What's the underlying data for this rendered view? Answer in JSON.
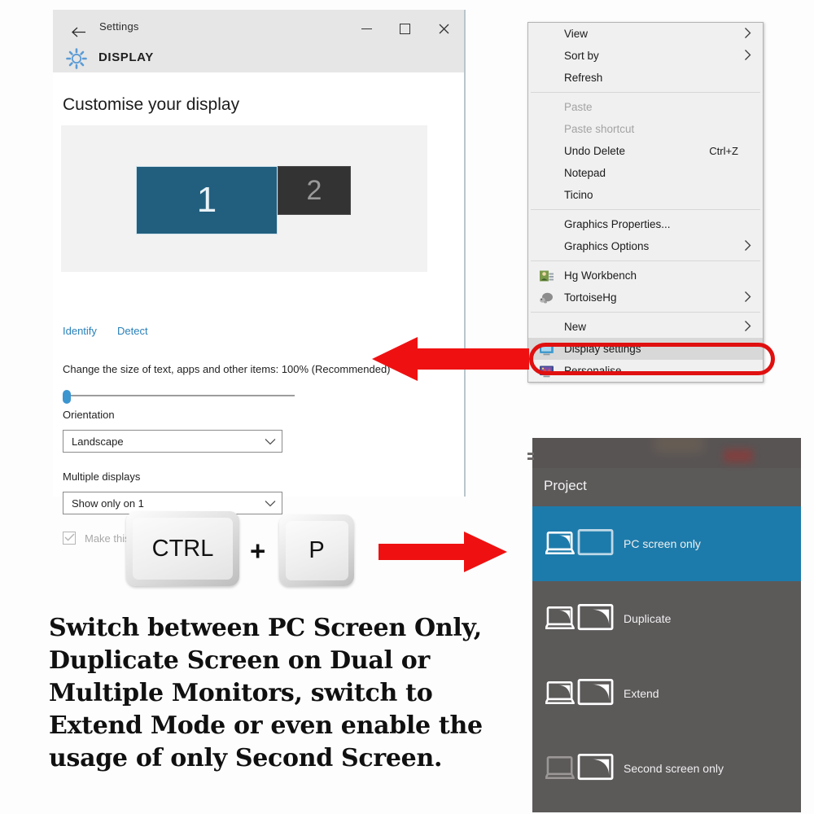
{
  "settings_window": {
    "titlebar": {
      "back_icon": "back-arrow-icon",
      "title": "Settings",
      "minimize": "minimize-icon",
      "maximize": "maximize-icon",
      "close": "close-icon"
    },
    "header": {
      "icon": "gear-icon",
      "label": "DISPLAY"
    },
    "heading": "Customise your display",
    "monitors": [
      {
        "label": "1",
        "color": "#225f7f",
        "state": "selected"
      },
      {
        "label": "2",
        "color": "#333333",
        "state": "normal"
      }
    ],
    "links": {
      "identify": "Identify",
      "detect": "Detect"
    },
    "scale": {
      "label": "Change the size of text, apps and other items: 100% (Recommended)",
      "value": 0
    },
    "orientation": {
      "label": "Orientation",
      "value": "Landscape",
      "caret": "chevron-down-icon"
    },
    "multiple_displays": {
      "label": "Multiple displays",
      "value": "Show only on 1",
      "caret": "chevron-down-icon"
    },
    "main_display_checkbox": {
      "label": "Make this my main display",
      "checked": true,
      "disabled": true
    }
  },
  "context_menu": {
    "items": [
      {
        "label": "View",
        "submenu": true,
        "disabled": false,
        "icon": null,
        "accel": ""
      },
      {
        "label": "Sort by",
        "submenu": true,
        "disabled": false,
        "icon": null,
        "accel": ""
      },
      {
        "label": "Refresh",
        "submenu": false,
        "disabled": false,
        "icon": null,
        "accel": ""
      },
      {
        "separator": true
      },
      {
        "label": "Paste",
        "submenu": false,
        "disabled": true,
        "icon": null,
        "accel": ""
      },
      {
        "label": "Paste shortcut",
        "submenu": false,
        "disabled": true,
        "icon": null,
        "accel": ""
      },
      {
        "label": "Undo Delete",
        "submenu": false,
        "disabled": false,
        "icon": null,
        "accel": "Ctrl+Z"
      },
      {
        "label": "Notepad",
        "submenu": false,
        "disabled": false,
        "icon": null,
        "accel": ""
      },
      {
        "label": "Ticino",
        "submenu": false,
        "disabled": false,
        "icon": null,
        "accel": ""
      },
      {
        "separator": true
      },
      {
        "label": "Graphics Properties...",
        "submenu": false,
        "disabled": false,
        "icon": null,
        "accel": ""
      },
      {
        "label": "Graphics Options",
        "submenu": true,
        "disabled": false,
        "icon": null,
        "accel": ""
      },
      {
        "separator": true
      },
      {
        "label": "Hg Workbench",
        "submenu": false,
        "disabled": false,
        "icon": "hg-workbench-icon",
        "accel": ""
      },
      {
        "label": "TortoiseHg",
        "submenu": true,
        "disabled": false,
        "icon": "tortoisehg-icon",
        "accel": ""
      },
      {
        "separator": true
      },
      {
        "label": "New",
        "submenu": true,
        "disabled": false,
        "icon": null,
        "accel": ""
      },
      {
        "label": "Display settings",
        "submenu": false,
        "disabled": false,
        "icon": "display-settings-icon",
        "accel": "",
        "highlighted": true
      },
      {
        "label": "Personalise",
        "submenu": false,
        "disabled": false,
        "icon": "personalise-icon",
        "accel": ""
      }
    ],
    "highlight_color": "#e01010"
  },
  "shortcut": {
    "key1": "CTRL",
    "plus": "+",
    "key2": "P"
  },
  "arrows": {
    "left_arrow": "arrow-left-icon",
    "right_arrow": "arrow-right-icon",
    "color": "#ef1111"
  },
  "caption": "Switch between PC Screen Only, Duplicate Screen on Dual or Multiple Monitors, switch to Extend Mode or even enable the usage of only Second Screen.",
  "project_panel": {
    "title": "Project",
    "selected_color": "#1d7bab",
    "background_color": "#5c5959",
    "items": [
      {
        "label": "PC screen only",
        "icon": "pc-screen-only-icon",
        "selected": true
      },
      {
        "label": "Duplicate",
        "icon": "duplicate-screen-icon",
        "selected": false
      },
      {
        "label": "Extend",
        "icon": "extend-screen-icon",
        "selected": false
      },
      {
        "label": "Second screen only",
        "icon": "second-screen-only-icon",
        "selected": false
      }
    ]
  }
}
